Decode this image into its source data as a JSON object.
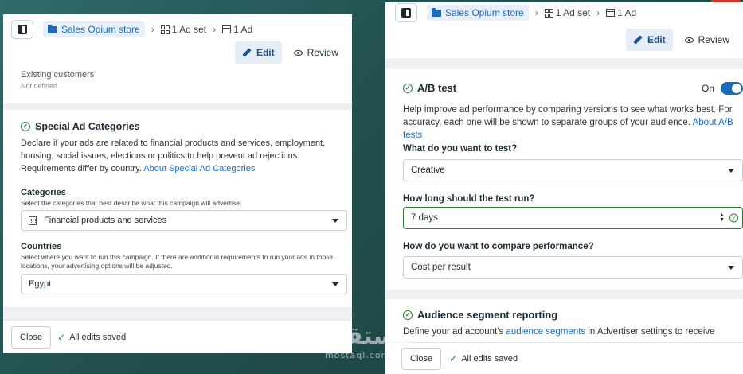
{
  "breadcrumb": {
    "campaign": "Sales Opium store",
    "adset": "1 Ad set",
    "ad": "1 Ad"
  },
  "actions": {
    "edit": "Edit",
    "review": "Review"
  },
  "left": {
    "existing_label": "Existing customers",
    "existing_value": "Not defined",
    "special": {
      "title": "Special Ad Categories",
      "desc": "Declare if your ads are related to financial products and services, employment, housing, social issues, elections or politics to help prevent ad rejections. Requirements differ by country.",
      "link": "About Special Ad Categories",
      "categories_label": "Categories",
      "categories_help": "Select the categories that best describe what this campaign will advertise.",
      "categories_value": "Financial products and services",
      "countries_label": "Countries",
      "countries_help": "Select where you want to run this campaign. If there are additional requirements to run your ads in those locations, your advertising options will be adjusted.",
      "countries_value": "Egypt"
    }
  },
  "right": {
    "ab": {
      "title": "A/B test",
      "toggle_label": "On",
      "toggle_on": true,
      "desc": "Help improve ad performance by comparing versions to see what works best. For accuracy, each one will be shown to separate groups of your audience.",
      "link": "About A/B tests",
      "q1": "What do you want to test?",
      "q1_value": "Creative",
      "q2": "How long should the test run?",
      "q2_value": "7 days",
      "q3": "How do you want to compare performance?",
      "q3_value": "Cost per result"
    },
    "audience": {
      "title": "Audience segment reporting",
      "desc_prefix": "Define your ad account's",
      "link": "audience segments",
      "desc_suffix": "in Advertiser settings to receive"
    }
  },
  "footer": {
    "close": "Close",
    "saved": "All edits saved"
  },
  "watermark": {
    "arabic": "مستقل",
    "latin": "mostaql.com"
  },
  "colors": {
    "accent": "#1d6bb8",
    "success": "#2e7d32",
    "background": "#23514f"
  }
}
